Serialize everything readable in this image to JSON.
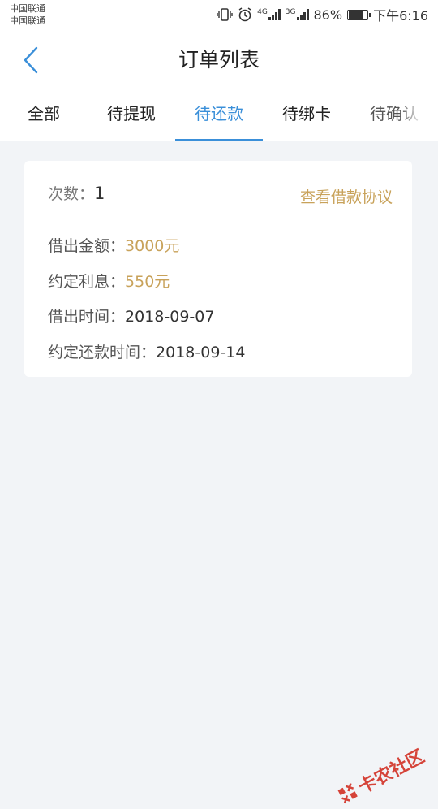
{
  "status_bar": {
    "carrier_1": "中国联通",
    "carrier_2": "中国联通",
    "net_1": "4G",
    "net_2": "3G",
    "battery": "86%",
    "battery_level": 0.86,
    "time": "下午6:16"
  },
  "nav": {
    "title": "订单列表",
    "back_icon": "chevron-left-icon"
  },
  "tabs": [
    {
      "label": "全部",
      "active": false
    },
    {
      "label": "待提现",
      "active": false
    },
    {
      "label": "待还款",
      "active": true
    },
    {
      "label": "待绑卡",
      "active": false
    },
    {
      "label": "待确认",
      "active": false
    }
  ],
  "order": {
    "count_label": "次数：",
    "count_value": "1",
    "agreement_link": "查看借款协议",
    "amount_label": "借出金额：",
    "amount_value": "3000元",
    "interest_label": "约定利息：",
    "interest_value": "550元",
    "lend_date_label": "借出时间：",
    "lend_date_value": "2018-09-07",
    "repay_date_label": "约定还款时间：",
    "repay_date_value": "2018-09-14"
  },
  "watermark": {
    "text": "卡农社区"
  },
  "colors": {
    "accent": "#3a8fd9",
    "gold": "#c8a25a",
    "background": "#f2f4f7"
  }
}
